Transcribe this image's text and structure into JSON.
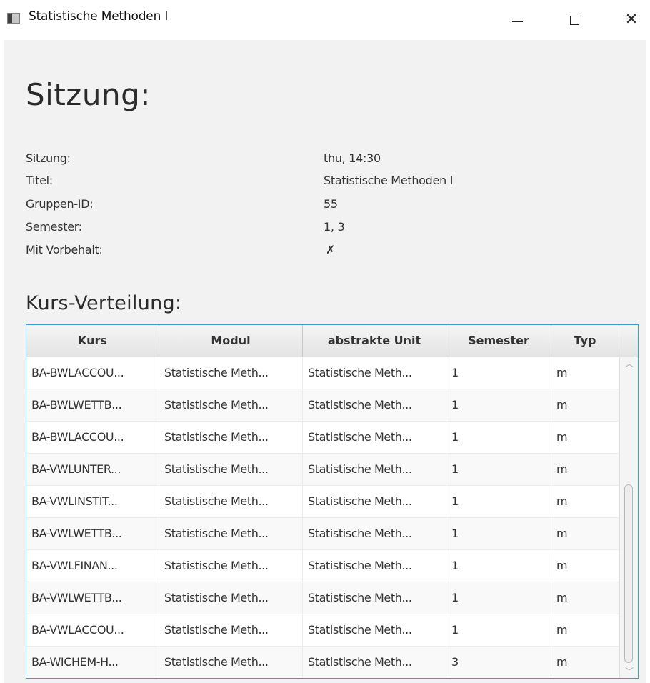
{
  "window": {
    "title": "Statistische Methoden I"
  },
  "heading": "Sitzung:",
  "info": [
    {
      "label": "Sitzung:",
      "value": "thu, 14:30"
    },
    {
      "label": "Titel:",
      "value": "Statistische Methoden I"
    },
    {
      "label": "Gruppen-ID:",
      "value": "55"
    },
    {
      "label": "Semester:",
      "value": "1, 3"
    },
    {
      "label": "Mit Vorbehalt:",
      "value": "✗"
    }
  ],
  "subheading": "Kurs-Verteilung:",
  "table": {
    "columns": [
      "Kurs",
      "Modul",
      "abstrakte Unit",
      "Semester",
      "Typ"
    ],
    "rows": [
      [
        "BA-BWLACCOU...",
        "Statistische Meth...",
        "Statistische Meth...",
        "1",
        "m"
      ],
      [
        "BA-BWLWETTB...",
        "Statistische Meth...",
        "Statistische Meth...",
        "1",
        "m"
      ],
      [
        "BA-BWLACCOU...",
        "Statistische Meth...",
        "Statistische Meth...",
        "1",
        "m"
      ],
      [
        "BA-VWLUNTER...",
        "Statistische Meth...",
        "Statistische Meth...",
        "1",
        "m"
      ],
      [
        "BA-VWLINSTIT...",
        "Statistische Meth...",
        "Statistische Meth...",
        "1",
        "m"
      ],
      [
        "BA-VWLWETTB...",
        "Statistische Meth...",
        "Statistische Meth...",
        "1",
        "m"
      ],
      [
        "BA-VWLFINAN...",
        "Statistische Meth...",
        "Statistische Meth...",
        "1",
        "m"
      ],
      [
        "BA-VWLWETTB...",
        "Statistische Meth...",
        "Statistische Meth...",
        "1",
        "m"
      ],
      [
        "BA-VWLACCOU...",
        "Statistische Meth...",
        "Statistische Meth...",
        "1",
        "m"
      ],
      [
        "BA-WICHEM-H...",
        "Statistische Meth...",
        "Statistische Meth...",
        "3",
        "m"
      ]
    ]
  },
  "icons": {
    "app": "app-window-icon",
    "minimize": "minimize-icon",
    "maximize": "maximize-icon",
    "close": "close-icon",
    "scroll_up": "chevron-up-icon",
    "scroll_down": "chevron-down-icon"
  }
}
